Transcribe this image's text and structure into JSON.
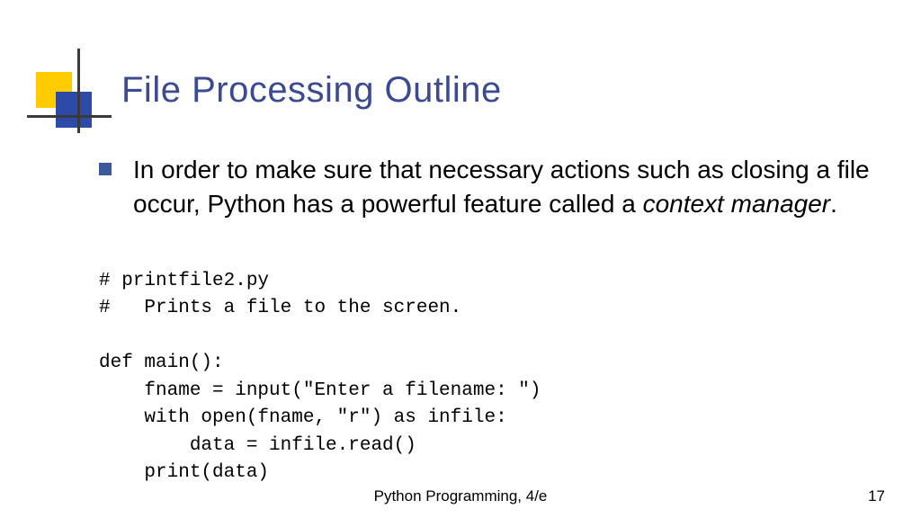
{
  "title": "File Processing Outline",
  "bullet": {
    "pre": "In order to make sure that necessary actions such as closing a file occur, Python has a powerful feature called a ",
    "em": "context manager",
    "post": "."
  },
  "code": "# printfile2.py\n#   Prints a file to the screen.\n\ndef main():\n    fname = input(\"Enter a filename: \")\n    with open(fname, \"r\") as infile:\n        data = infile.read()\n    print(data)",
  "footer": {
    "center": "Python Programming, 4/e",
    "page": "17"
  }
}
